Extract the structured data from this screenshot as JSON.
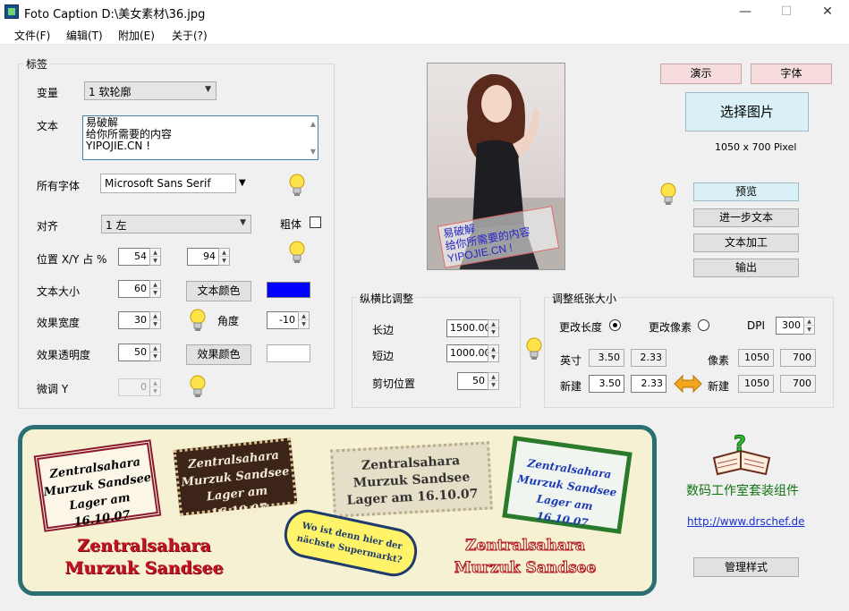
{
  "window": {
    "title": "Foto Caption D:\\美女素材\\36.jpg",
    "minimize": "—",
    "maximize": "☐",
    "close": "✕"
  },
  "menu": [
    "文件(F)",
    "编辑(T)",
    "附加(E)",
    "关于(?)"
  ],
  "tags_group": {
    "title": "标签",
    "variant_label": "变量",
    "variant_value": "1 软轮廓",
    "text_label": "文本",
    "text_lines": [
      "易破解",
      "给你所需要的内容",
      "YIPOJIE.CN !"
    ],
    "font_label": "所有字体",
    "font_value": "Microsoft Sans Serif",
    "align_label": "对齐",
    "align_value": "1 左",
    "bold_label": "粗体",
    "bold_checked": false,
    "position_label": "位置 X/Y 占 %",
    "pos_x": "54",
    "pos_y": "94",
    "text_size_label": "文本大小",
    "text_size": "60",
    "text_color_button": "文本颜色",
    "text_color": "#0000ff",
    "effect_width_label": "效果宽度",
    "effect_width": "30",
    "angle_label": "角度",
    "angle": "-10",
    "effect_opacity_label": "效果透明度",
    "effect_opacity": "50",
    "effect_color_button": "效果颜色",
    "effect_color": "#ffffff",
    "fine_y_label": "微调 Y",
    "fine_y": "0"
  },
  "preview_photo": {
    "caption_lines": [
      "易破解",
      "给你所需要的内容",
      "YIPOJIE.CN !"
    ]
  },
  "right_panel": {
    "demo_button": "演示",
    "font_button": "字体",
    "select_image_button": "选择图片",
    "image_size": "1050 x 700 Pixel",
    "preview_button": "预览",
    "further_text_button": "进一步文本",
    "text_process_button": "文本加工",
    "output_button": "输出"
  },
  "aspect_group": {
    "title": "纵横比调整",
    "long_label": "长边",
    "long_value": "1500.00",
    "short_label": "短边",
    "short_value": "1000.00",
    "crop_label": "剪切位置",
    "crop_value": "50"
  },
  "paper_group": {
    "title": "调整纸张大小",
    "change_length": "更改长度",
    "change_pixel": "更改像素",
    "selected": "change_length",
    "dpi_label": "DPI",
    "dpi_value": "300",
    "inch_label": "英寸",
    "inch_w": "3.50",
    "inch_h": "2.33",
    "pixel_label": "像素",
    "pixel_w": "1050",
    "pixel_h": "700",
    "new_label": "新建",
    "new_inch_w": "3.50",
    "new_inch_h": "2.33",
    "new_label2": "新建",
    "new_pixel_w": "1050",
    "new_pixel_h": "700"
  },
  "samples": {
    "stamp1": [
      "Zentralsahara",
      "Murzuk Sandsee",
      "Lager am 16.10.07"
    ],
    "stamp2": [
      "Zentralsahara",
      "Murzuk Sandsee",
      "Lager am 16.10.07"
    ],
    "stamp3": [
      "Zentralsahara",
      "Murzuk Sandsee",
      "Lager am 16.10.07"
    ],
    "stamp4": [
      "Zentralsahara",
      "Murzuk Sandsee",
      "Lager am 16.10.07"
    ],
    "bubble": [
      "Wo ist denn hier der",
      "nächste Supermarkt?"
    ],
    "red_left": [
      "Zentralsahara",
      "Murzuk Sandsee"
    ],
    "red_right": [
      "Zentralsahara",
      "Murzuk Sandsee"
    ]
  },
  "promo": {
    "name": "数码工作室套装组件",
    "link": "http://www.drschef.de",
    "manage_button": "管理样式"
  }
}
